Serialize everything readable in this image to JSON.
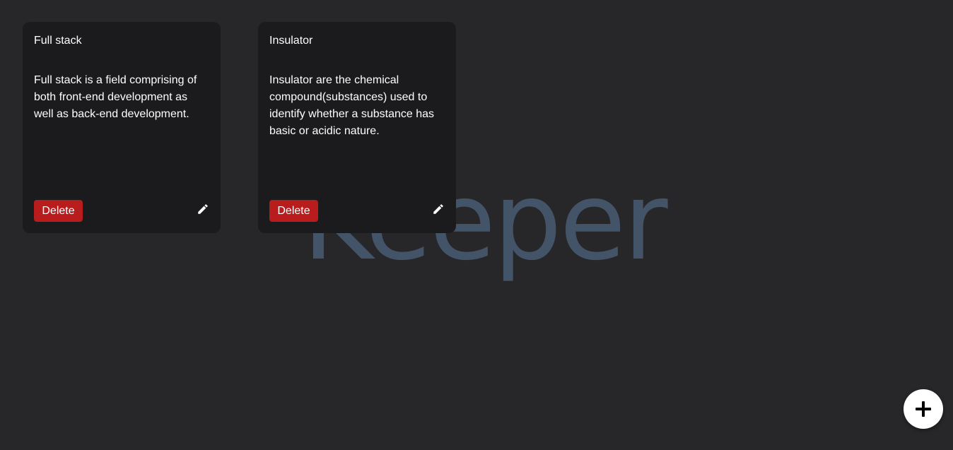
{
  "app": {
    "watermark": "Keeper"
  },
  "notes": [
    {
      "title": "Full stack",
      "content": "Full stack is a field comprising of both front-end development as well as back-end development.",
      "delete_label": "Delete",
      "edit_icon": "pencil-icon"
    },
    {
      "title": "Insulator",
      "content": "Insulator are the chemical compound(substances) used to identify whether a substance has basic or acidic nature.",
      "delete_label": "Delete",
      "edit_icon": "pencil-icon"
    }
  ],
  "fab": {
    "icon": "plus-icon"
  },
  "colors": {
    "background": "#27272a",
    "card": "#1b1b1e",
    "delete": "#b91c1c",
    "watermark": "#445468",
    "fab": "#ffffff"
  }
}
